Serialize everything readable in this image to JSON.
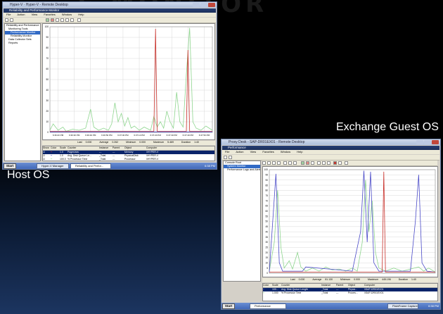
{
  "captions": {
    "host": "Host OS",
    "guest": "Exchange Guest OS"
  },
  "watermark": "E MONITOR",
  "host_window": {
    "title": "Hyper-V · Hyper-V - Remote Desktop",
    "app_title": "Reliability and Performance Monitor",
    "menu": [
      "File",
      "Action",
      "View",
      "Favorites",
      "Window",
      "Help"
    ],
    "tree": [
      {
        "label": "Reliability and Performance",
        "selected": false
      },
      {
        "label": "Monitoring Tools",
        "selected": false
      },
      {
        "label": "Performance Monitor",
        "selected": true
      },
      {
        "label": "Reliability Monitor",
        "selected": false
      },
      {
        "label": "Data Collector Sets",
        "selected": false
      },
      {
        "label": "Reports",
        "selected": false
      }
    ],
    "y_ticks": [
      "100",
      "90",
      "80",
      "70",
      "60",
      "50",
      "40",
      "30",
      "20",
      "10",
      "0"
    ],
    "x_ticks": [
      "6:36:20 PM",
      "6:36:30 PM",
      "6:36:40 PM",
      "6:36:50 PM",
      "6:37:00 PM",
      "6:37:10 PM",
      "6:37:20 PM",
      "6:37:30 PM",
      "6:37:40 PM",
      "6:37:50 PM"
    ],
    "stats": {
      "last_label": "Last",
      "last": "0.000",
      "avg_label": "Average",
      "avg": "0.262",
      "min_label": "Minimum",
      "min": "0.000",
      "max_label": "Maximum",
      "max": "5.469",
      "dur_label": "Duration",
      "dur": "1:40"
    },
    "legend_headers": [
      "Show",
      "Color",
      "Scale",
      "Counter",
      "Instance",
      "Parent",
      "Object",
      "Computer"
    ],
    "legend_rows": [
      {
        "scale": "1.0",
        "counter": "Pages/sec",
        "instance": "---",
        "parent": "---",
        "object": "Memory",
        "computer": "\\\\HYPER-V",
        "selected": true
      },
      {
        "scale": "1.0",
        "counter": "Avg. Disk Queue Le...",
        "instance": "_Total",
        "parent": "---",
        "object": "PhysicalDisk",
        "computer": "\\\\HYPER-V",
        "selected": false
      },
      {
        "scale": "100.0",
        "counter": "% Processor Time",
        "instance": "_Total",
        "parent": "---",
        "object": "Processor",
        "computer": "\\\\HYPER-V",
        "selected": false
      }
    ],
    "taskbar": {
      "start": "Start",
      "tasks": [
        "Hyper-V Manager",
        "Reliability and Perfor..."
      ],
      "clock": "6:38 PM"
    }
  },
  "guest_window": {
    "title": "Proxy Desk - SAP-DR01EX01 - Remote Desktop",
    "app_title": "Performance",
    "menu": [
      "File",
      "Action",
      "View",
      "Favorites",
      "Window",
      "Help"
    ],
    "tree": [
      {
        "label": "Console Root",
        "selected": false
      },
      {
        "label": "System Monitor",
        "selected": true
      },
      {
        "label": "Performance Logs and Alerts",
        "selected": false
      }
    ],
    "y_ticks": [
      "100",
      "95",
      "90",
      "85",
      "80",
      "75",
      "70",
      "65",
      "60",
      "55",
      "50",
      "45",
      "40",
      "35",
      "30",
      "25",
      "20",
      "15",
      "10",
      "5",
      "0"
    ],
    "stats": {
      "last_label": "Last",
      "last": "0.000",
      "avg_label": "Average",
      "avg": "81.130",
      "min_label": "Minimum",
      "min": "0.000",
      "max_label": "Maximum",
      "max": "445.196",
      "dur_label": "Duration",
      "dur": "1:40"
    },
    "legend_headers": [
      "Color",
      "Scale",
      "Counter",
      "Instance",
      "Parent",
      "Object",
      "Computer"
    ],
    "legend_rows": [
      {
        "scale": "100...",
        "counter": "Avg. Disk Queue Length",
        "instance": "_Total",
        "parent": "---",
        "object": "Physic...",
        "computer": "\\\\SAP-DR01EX01",
        "selected": true
      },
      {
        "scale": "1.000",
        "counter": "% Processor Time",
        "instance": "_Total",
        "parent": "---",
        "object": "Proces...",
        "computer": "\\\\SAP-DR01EX01",
        "selected": false
      }
    ],
    "taskbar": {
      "start": "Start",
      "tasks": [
        "Performance"
      ],
      "tray": "PlainFrame Capture",
      "clock": "6:38 PM"
    }
  },
  "colors": {
    "green": "#8ed58e",
    "red": "#c8302a",
    "blue": "#4a4ac8",
    "selection": "#316ac5"
  }
}
